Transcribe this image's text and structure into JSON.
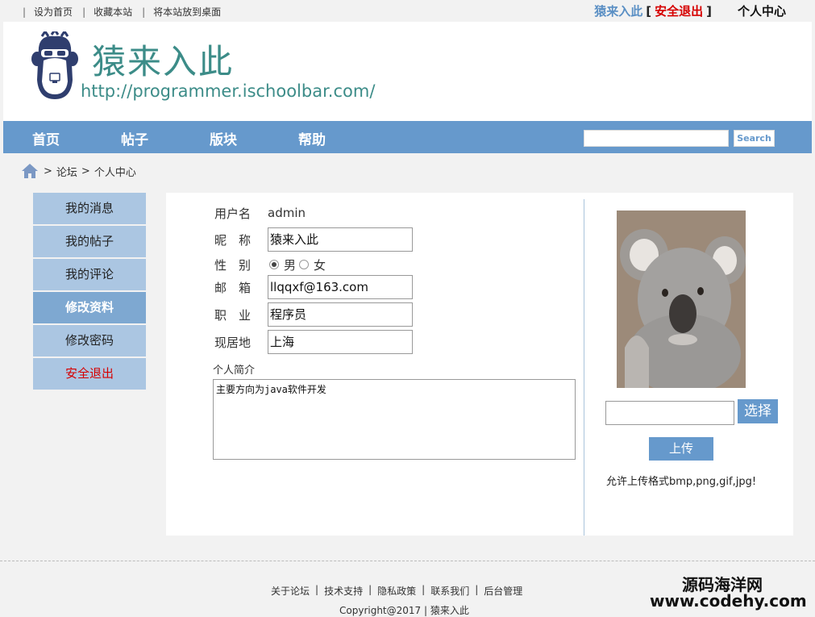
{
  "topbar": {
    "links": [
      "设为首页",
      "收藏本站",
      "将本站放到桌面"
    ],
    "username": "猿来入此",
    "logout_label": "安全退出",
    "user_center": "个人中心"
  },
  "header": {
    "title": "猿来入此",
    "url": "http://programmer.ischoolbar.com/"
  },
  "nav": {
    "items": [
      "首页",
      "帖子",
      "版块",
      "帮助"
    ],
    "search_value": "",
    "search_label": "Search"
  },
  "breadcrumb": {
    "items": [
      "论坛",
      "个人中心"
    ]
  },
  "sidebar": {
    "items": [
      "我的消息",
      "我的帖子",
      "我的评论",
      "修改资料",
      "修改密码",
      "安全退出"
    ],
    "active_index": 3
  },
  "profile": {
    "username_label": "用户名",
    "username_value": "admin",
    "nickname_label": "昵　称",
    "nickname_value": "猿来入此",
    "gender_label": "性　别",
    "gender_male": "男",
    "gender_female": "女",
    "gender_selected": "男",
    "email_label": "邮　箱",
    "email_value": "llqqxf@163.com",
    "job_label": "职　业",
    "job_value": "程序员",
    "location_label": "现居地",
    "location_value": "上海",
    "intro_label": "个人简介",
    "intro_value": "主要方向为java软件开发"
  },
  "avatar": {
    "file_value": "",
    "choose_label": "选择",
    "upload_label": "上传",
    "allowed_text": "允许上传格式bmp,png,gif,jpg!"
  },
  "footer": {
    "links": [
      "关于论坛",
      "技术支持",
      "隐私政策",
      "联系我们",
      "后台管理"
    ],
    "copyright": "Copyright@2017 | 猿来入此",
    "watermark_line1": "源码海洋网",
    "watermark_line2": "www.codehy.com"
  },
  "colors": {
    "nav_blue": "#6699cc",
    "title_teal": "#3c8c88",
    "logout_red": "#d60000"
  }
}
